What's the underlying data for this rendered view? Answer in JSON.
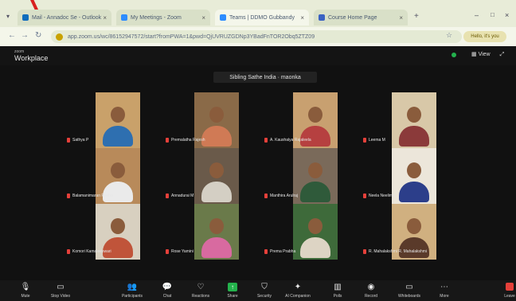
{
  "browser": {
    "tabs": [
      {
        "label": "Mail - Annadoc Se - Outlook",
        "active": false,
        "color": "#0f6cbd"
      },
      {
        "label": "My Meetings - Zoom",
        "active": false,
        "color": "#2d8cff"
      },
      {
        "label": "Teams | DDMO Gubbandy",
        "active": true,
        "color": "#2d8cff"
      },
      {
        "label": "Course Home Page",
        "active": false,
        "color": "#3a62c2"
      }
    ],
    "url": "app.zoom.us/wc/86152947572/start?fromPWA=1&pwd=QjUVRUZGDNp3YBadFnTOR2Obq5ZTZ09",
    "profile_label": "Hello, it's you"
  },
  "zoom": {
    "brand_small": "zoom",
    "brand_big": "Workplace",
    "view_label": "View",
    "share_banner": "Sibling Sathe India · maonka"
  },
  "participants": [
    {
      "name": "Sathya P",
      "bg": "#c9a16a",
      "body": "#2e6fb0"
    },
    {
      "name": "Premalatha Rajesh",
      "bg": "#8a6a48",
      "body": "#d07a55"
    },
    {
      "name": "A. Kaushalya Rajaleela",
      "bg": "#c8a070",
      "body": "#b64040"
    },
    {
      "name": "Leema M",
      "bg": "#d8c8a8",
      "body": "#8b3a3a"
    },
    {
      "name": "Balamanimaran Rasha",
      "bg": "#b88a5a",
      "body": "#eaeaea"
    },
    {
      "name": "Annadurai M",
      "bg": "#6a5a4a",
      "body": "#d4cfc4"
    },
    {
      "name": "Manthira Arulraj",
      "bg": "#7a6a5a",
      "body": "#2f5a3a"
    },
    {
      "name": "Neela Neelima",
      "bg": "#ece6da",
      "body": "#2c3e8a"
    },
    {
      "name": "Komori Kamaleeswari",
      "bg": "#d8d0c0",
      "body": "#c0543a"
    },
    {
      "name": "Rose Yamini",
      "bg": "#6a7a4a",
      "body": "#d86aa0"
    },
    {
      "name": "Prema Prabha",
      "bg": "#3e6a3a",
      "body": "#ddd4c4"
    },
    {
      "name": "R. Mahalakshmi R. Mahalakshmi",
      "bg": "#d0b080",
      "body": "#5a3a2a"
    }
  ],
  "toolbar": [
    {
      "id": "mute",
      "label": "Mute",
      "icon": "mic-icon"
    },
    {
      "id": "video",
      "label": "Stop Video",
      "icon": "video-icon"
    },
    {
      "id": "participants",
      "label": "Participants",
      "icon": "people-icon"
    },
    {
      "id": "chat",
      "label": "Chat",
      "icon": "chat-icon"
    },
    {
      "id": "reactions",
      "label": "Reactions",
      "icon": "heart-icon"
    },
    {
      "id": "share",
      "label": "Share",
      "icon": "share-icon"
    },
    {
      "id": "security",
      "label": "Security",
      "icon": "shield-icon"
    },
    {
      "id": "ai",
      "label": "AI Companion",
      "icon": "sparkle-icon"
    },
    {
      "id": "polls",
      "label": "Polls",
      "icon": "bar-chart-icon"
    },
    {
      "id": "record",
      "label": "Record",
      "icon": "record-icon"
    },
    {
      "id": "whiteboards",
      "label": "Whiteboards",
      "icon": "whiteboard-icon"
    },
    {
      "id": "more",
      "label": "More",
      "icon": "more-icon"
    },
    {
      "id": "leave",
      "label": "Leave",
      "icon": "leave-icon"
    }
  ]
}
